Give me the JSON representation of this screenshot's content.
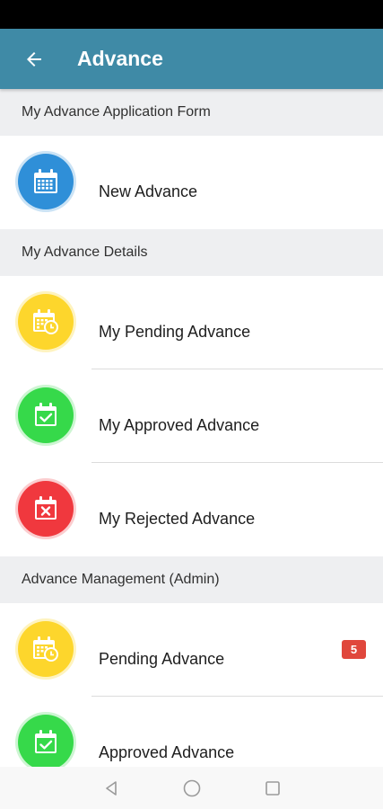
{
  "app_bar": {
    "title": "Advance",
    "background": "#3f8aa6",
    "back_icon": "arrow-left-icon"
  },
  "sections": [
    {
      "header": "My Advance Application Form",
      "items": [
        {
          "label": "New Advance",
          "icon": "calendar-icon",
          "icon_color": "#2f8fd8"
        }
      ]
    },
    {
      "header": "My Advance Details",
      "items": [
        {
          "label": "My Pending Advance",
          "icon": "calendar-clock-icon",
          "icon_color": "#fdd62c"
        },
        {
          "label": "My Approved Advance",
          "icon": "calendar-check-icon",
          "icon_color": "#36d94a"
        },
        {
          "label": "My Rejected Advance",
          "icon": "calendar-x-icon",
          "icon_color": "#f0383e"
        }
      ]
    },
    {
      "header": "Advance Management (Admin)",
      "items": [
        {
          "label": "Pending Advance",
          "icon": "calendar-clock-icon",
          "icon_color": "#fdd62c",
          "badge": "5"
        },
        {
          "label": "Approved Advance",
          "icon": "calendar-check-icon",
          "icon_color": "#36d94a"
        }
      ]
    }
  ],
  "colors": {
    "badge": "#e0473c"
  },
  "system_nav": {
    "back": "triangle-back-icon",
    "home": "circle-home-icon",
    "recents": "square-recents-icon"
  }
}
